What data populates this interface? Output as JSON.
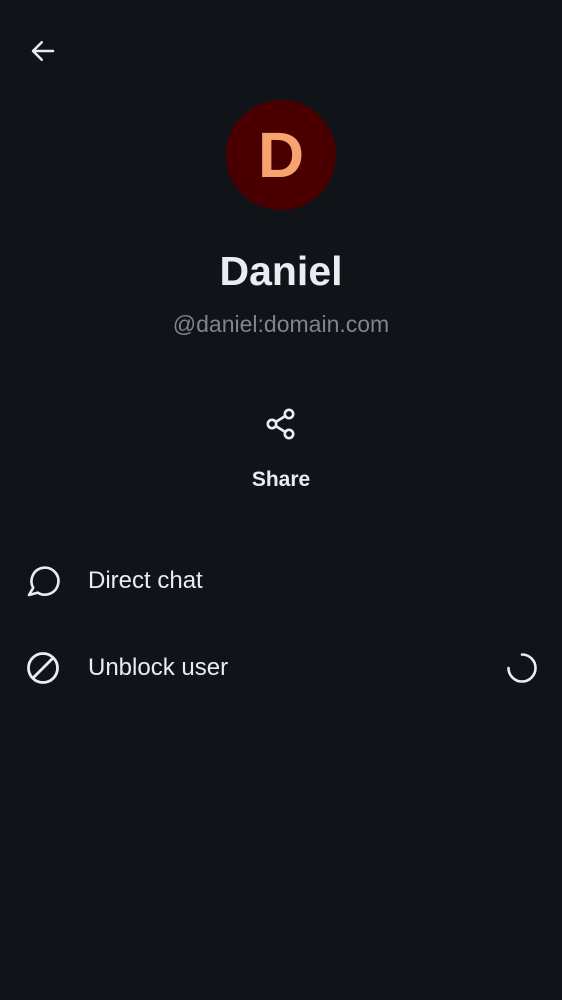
{
  "header": {
    "back_icon": "arrow-left-icon"
  },
  "profile": {
    "avatar_initial": "D",
    "avatar_bg": "#4a0000",
    "avatar_fg": "#f6a36f",
    "display_name": "Daniel",
    "user_id": "@daniel:domain.com"
  },
  "actions": {
    "share": {
      "label": "Share",
      "icon": "share-icon"
    }
  },
  "list": {
    "items": [
      {
        "label": "Direct chat",
        "icon": "chat-bubble-icon"
      },
      {
        "label": "Unblock user",
        "icon": "block-icon",
        "loading": true
      }
    ]
  },
  "colors": {
    "background": "#101317",
    "primary_text": "#e9ecf1",
    "secondary_text": "#7d8591"
  }
}
